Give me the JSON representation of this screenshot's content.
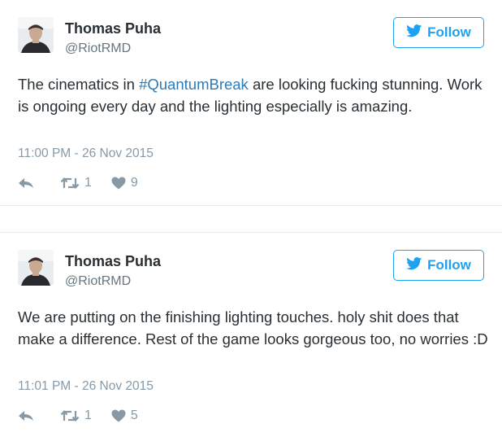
{
  "colors": {
    "accent": "#1da1f2",
    "hashtag": "#2b7bb9",
    "text": "#292f33",
    "muted": "#8899a6",
    "divider": "#e6ecf0"
  },
  "icons": {
    "follow": "twitter-bird-icon",
    "reply": "reply-arrow-icon",
    "retweet": "retweet-icon",
    "like": "heart-icon"
  },
  "tweets": [
    {
      "author": {
        "name": "Thomas Puha",
        "handle": "@RiotRMD"
      },
      "follow_label": "Follow",
      "text_before": "The cinematics in ",
      "hashtag": "#QuantumBreak",
      "text_after": " are looking fucking stunning. Work is ongoing every day and the lighting especially is amazing.",
      "timestamp": "11:00 PM - 26 Nov 2015",
      "retweets": "1",
      "likes": "9"
    },
    {
      "author": {
        "name": "Thomas Puha",
        "handle": "@RiotRMD"
      },
      "follow_label": "Follow",
      "text": "We are putting on the finishing lighting touches. holy shit does that make a difference. Rest of the game looks gorgeous too, no worries :D",
      "timestamp": "11:01 PM - 26 Nov 2015",
      "retweets": "1",
      "likes": "5"
    }
  ]
}
